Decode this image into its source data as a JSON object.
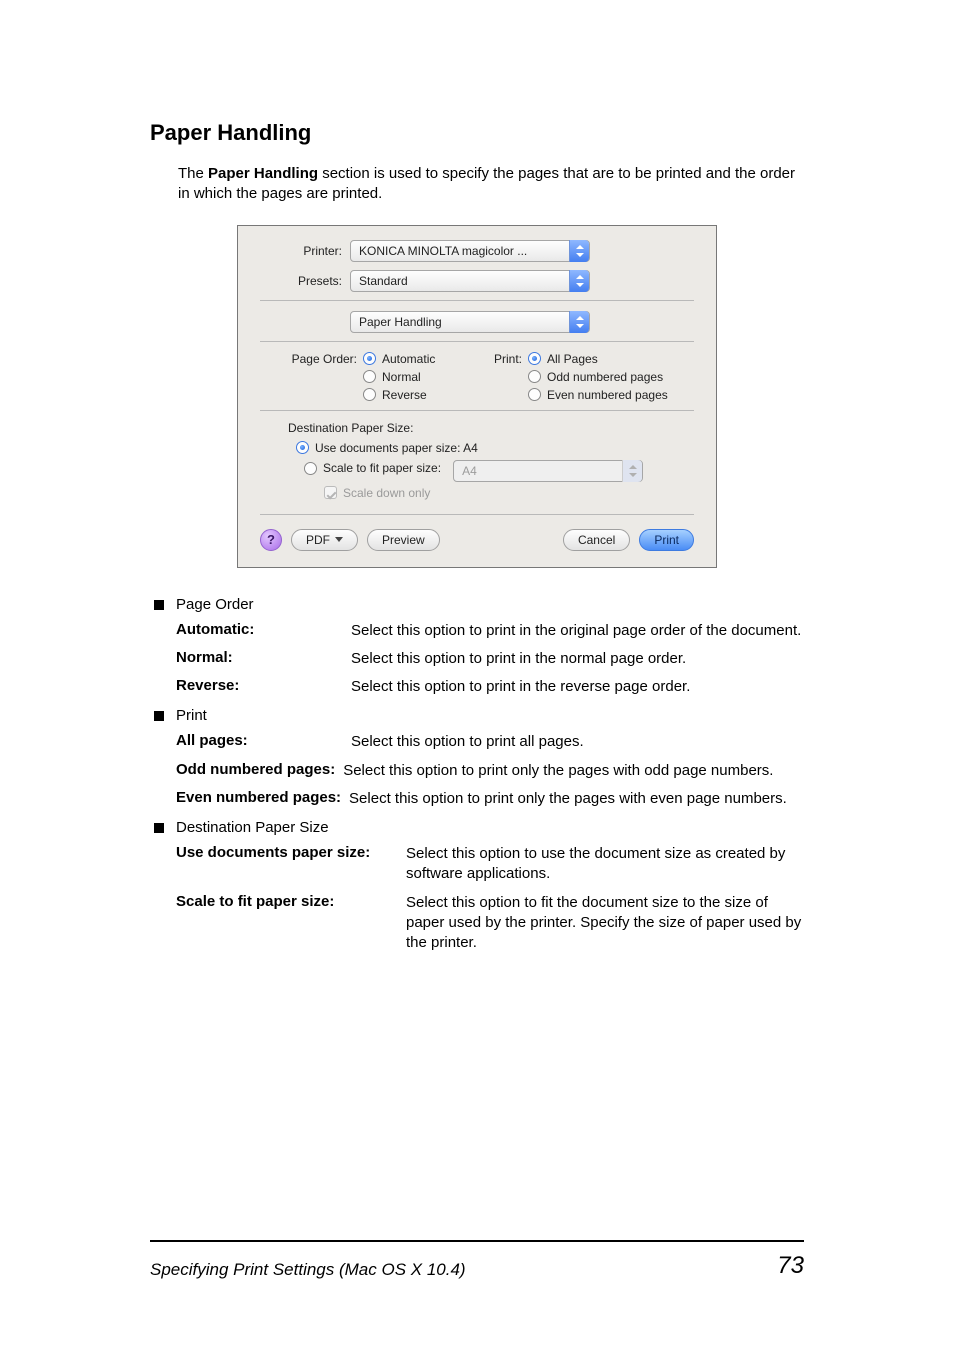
{
  "heading": "Paper Handling",
  "intro_pre": "The ",
  "intro_bold": "Paper Handling",
  "intro_post": " section is used to specify the pages that are to be printed and the order in which the pages are printed.",
  "dialog": {
    "printer_label": "Printer:",
    "printer_value": "KONICA MINOLTA magicolor ...",
    "presets_label": "Presets:",
    "presets_value": "Standard",
    "panel_value": "Paper Handling",
    "page_order_label": "Page Order:",
    "page_order_opts": [
      "Automatic",
      "Normal",
      "Reverse"
    ],
    "print_label": "Print:",
    "print_opts": [
      "All Pages",
      "Odd numbered pages",
      "Even numbered pages"
    ],
    "dest_title": "Destination Paper Size:",
    "use_docs_label": "Use documents paper size:  A4",
    "scale_label": "Scale to fit paper size:",
    "scale_value": "A4",
    "scale_down": "Scale down only",
    "help": "?",
    "pdf": "PDF",
    "preview": "Preview",
    "cancel": "Cancel",
    "print": "Print"
  },
  "list": {
    "b1": "Page Order",
    "b1_items": [
      {
        "term": "Automatic:",
        "desc": "Select this option to print in the original page order of the document."
      },
      {
        "term": "Normal:",
        "desc": "Select this option to print in the normal page order."
      },
      {
        "term": "Reverse:",
        "desc": "Select this option to print in the reverse page order."
      }
    ],
    "b2": "Print",
    "b2_items": [
      {
        "term": "All pages:",
        "desc": "Select this option to print all pages."
      },
      {
        "term": "Odd numbered pages:",
        "desc": "Select this option to print only the pages with odd page numbers."
      },
      {
        "term": "Even numbered pages:",
        "desc": "Select this option to print only the pages with even page numbers."
      }
    ],
    "b3": "Destination Paper Size",
    "b3_items": [
      {
        "term": "Use documents paper size:",
        "desc": "Select this option to use the document size as created by software applications."
      },
      {
        "term": "Scale to fit paper size:",
        "desc": "Select this option to fit the document size to the size of paper used by the printer. Specify the size of paper used by the printer."
      }
    ]
  },
  "footer": {
    "title": "Specifying Print Settings (Mac OS X 10.4)",
    "page": "73"
  }
}
